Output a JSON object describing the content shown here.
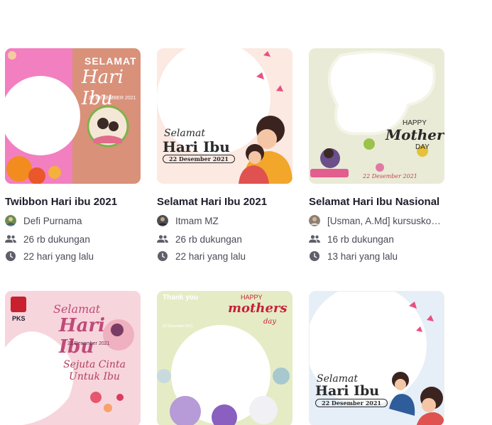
{
  "cards": [
    {
      "title": "Twibbon Hari ibu 2021",
      "author": "Defi Purnama",
      "supports": "26 rb dukungan",
      "time": "22 hari yang lalu",
      "thumb": {
        "line1": "SELAMAT",
        "line2": "Hari Ibu",
        "date": "22 DESEMBER 2021",
        "bg": "#d9917a"
      }
    },
    {
      "title": "Selamat Hari Ibu 2021",
      "author": "Itmam MZ",
      "supports": "26 rb dukungan",
      "time": "22 hari yang lalu",
      "thumb": {
        "line1": "Selamat",
        "line2": "Hari Ibu",
        "date": "22 Desember 2021",
        "bg": "#fbe9e2"
      }
    },
    {
      "title": "Selamat Hari Ibu Nasional",
      "author": "[Usman, A.Md] kursuskomputerdankonsultanit",
      "supports": "16 rb dukungan",
      "time": "13 hari yang lalu",
      "thumb": {
        "line1": "HAPPY",
        "line2": "Mother's",
        "line3": "DAY",
        "date": "22 Desember 2021",
        "bg": "#e9ebd6"
      }
    },
    {
      "thumb": {
        "brand": "PKS",
        "line1": "Selamat",
        "line2": "Hari Ibu",
        "date": "22 Desember 2021",
        "tagline": "Sejuta Cinta Untuk Ibu",
        "bg": "#f7d5dc"
      }
    },
    {
      "thumb": {
        "line1": "HAPPY",
        "line2": "mothers",
        "line3": "day",
        "quote": "Thank you",
        "date": "22 Desember 2021",
        "bg": "#e5ecc5"
      }
    },
    {
      "thumb": {
        "line1": "Selamat",
        "line2": "Hari Ibu",
        "date": "22 Desember 2021",
        "bg": "#ffffff"
      }
    }
  ]
}
